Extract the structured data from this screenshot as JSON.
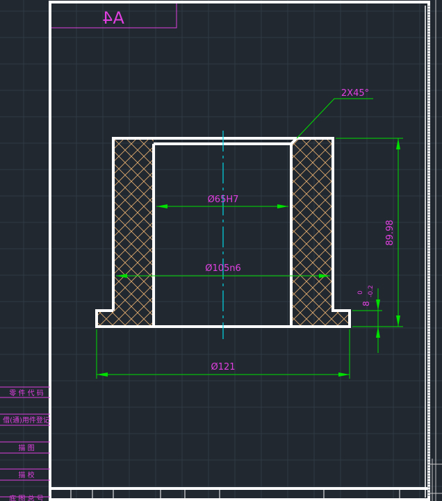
{
  "sheet": {
    "format_label": "A4"
  },
  "dimensions": {
    "chamfer": "2X45°",
    "bore": "Ø65H7",
    "outer": "Ø105n6",
    "flange": "Ø121",
    "height": "89.98",
    "flange_thickness": "8",
    "tol_upper": "0",
    "tol_lower": "-0.2"
  },
  "side_table": {
    "part_code": "零 件 代 码",
    "used_on": "借(通)用件登记",
    "drawn": "描    图",
    "checked": "描    校",
    "bottom": "底 图 总 号"
  },
  "colors": {
    "background": "#212830",
    "outline": "#ffffff",
    "dimension": "#00e000",
    "text": "#e040e0",
    "centerline": "#00d8e8",
    "hatch": "#e8b070",
    "grid": "#2f3a44"
  }
}
